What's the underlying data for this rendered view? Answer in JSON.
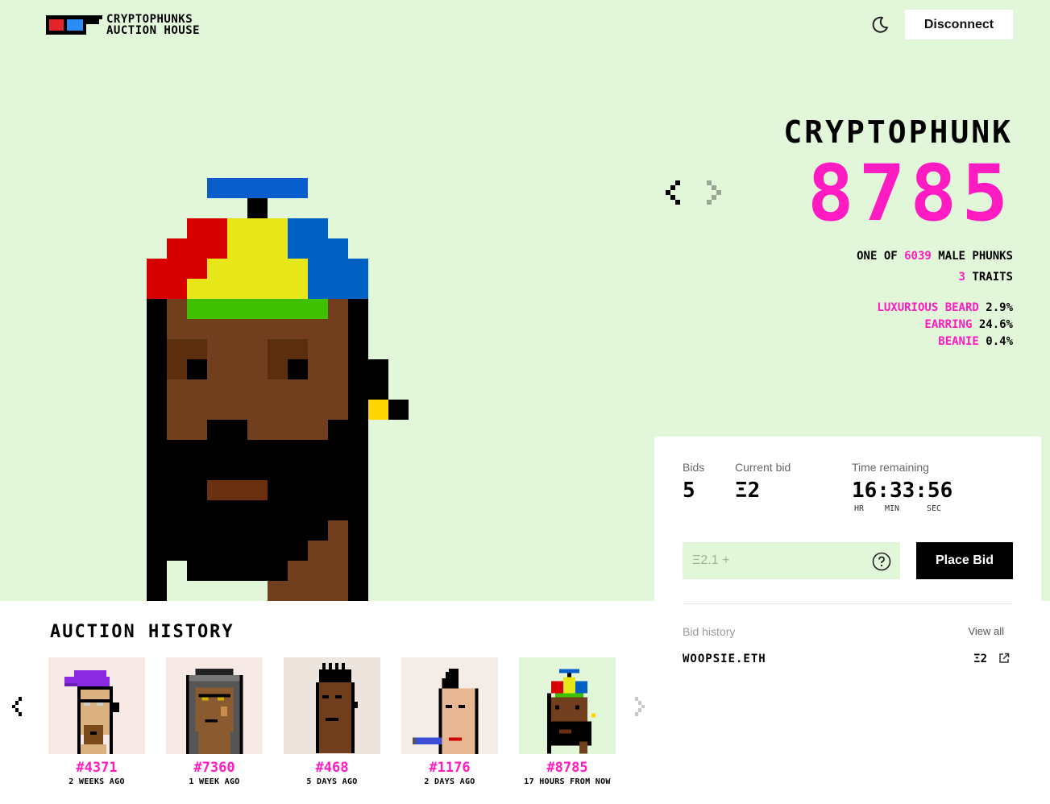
{
  "header": {
    "brand_line1": "CRYPTOPHUNKS",
    "brand_line2": "AUCTION HOUSE",
    "disconnect_label": "Disconnect"
  },
  "phunk": {
    "title": "CRYPTOPHUNK",
    "number": "8785",
    "one_of_prefix": "ONE OF ",
    "one_of_count": "6039",
    "one_of_suffix": " MALE PHUNKS",
    "traits_count": "3",
    "traits_label": " TRAITS",
    "traits": [
      {
        "name": "LUXURIOUS BEARD",
        "pct": "2.9%"
      },
      {
        "name": "EARRING",
        "pct": "24.6%"
      },
      {
        "name": "BEANIE",
        "pct": "0.4%"
      }
    ]
  },
  "auction": {
    "bids_label": "Bids",
    "bids_value": "5",
    "current_bid_label": "Current bid",
    "current_bid_value": "Ξ2",
    "time_label": "Time remaining",
    "time_value": "16:33:56",
    "units": [
      "HR",
      "MIN",
      "SEC"
    ],
    "bid_placeholder": "Ξ2.1 +",
    "place_bid_label": "Place Bid",
    "bid_history_label": "Bid history",
    "view_all_label": "View all",
    "history": [
      {
        "bidder": "WOOPSIE.ETH",
        "amount": "Ξ2"
      }
    ]
  },
  "auction_history": {
    "title": "AUCTION HISTORY",
    "items": [
      {
        "number": "#4371",
        "time": "2 WEEKS AGO"
      },
      {
        "number": "#7360",
        "time": "1 WEEK AGO"
      },
      {
        "number": "#468",
        "time": "5 DAYS AGO"
      },
      {
        "number": "#1176",
        "time": "2 DAYS AGO"
      },
      {
        "number": "#8785",
        "time": "17 HOURS FROM NOW"
      }
    ]
  },
  "colors": {
    "accent_pink": "#ff1bc2",
    "hero_bg": "#e2f6da",
    "skin_dark": "#713f1d"
  },
  "icons": {
    "theme_toggle": "moon-icon",
    "help": "question-circle-icon",
    "external": "external-link-icon",
    "prev": "chevron-left-icon",
    "next": "chevron-right-icon"
  }
}
